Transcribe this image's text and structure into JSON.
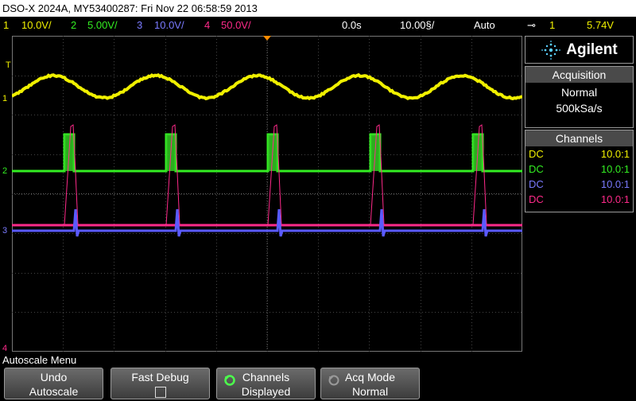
{
  "title": "DSO-X 2024A, MY53400287: Fri Nov 22 06:58:59 2013",
  "status": {
    "ch1_num": "1",
    "ch1_scale": "10.0V/",
    "ch2_num": "2",
    "ch2_scale": "5.00V/",
    "ch3_num": "3",
    "ch3_scale": "10.0V/",
    "ch4_num": "4",
    "ch4_scale": "50.0V/",
    "time_delay": "0.0s",
    "time_scale": "10.00§/",
    "trigger_mode": "Auto",
    "trigger_source": "1",
    "trigger_level": "5.74V"
  },
  "brand": "Agilent",
  "acquisition": {
    "header": "Acquisition",
    "mode": "Normal",
    "rate": "500kSa/s"
  },
  "channels": {
    "header": "Channels",
    "rows": [
      {
        "coupling": "DC",
        "probe": "10.0:1",
        "color": "#f0f000"
      },
      {
        "coupling": "DC",
        "probe": "10.0:1",
        "color": "#33ee22"
      },
      {
        "coupling": "DC",
        "probe": "10.0:1",
        "color": "#7a7aff"
      },
      {
        "coupling": "DC",
        "probe": "10.0:1",
        "color": "#ff2a8a"
      }
    ]
  },
  "markers": {
    "trigger": "T",
    "ch1": "1",
    "ch2": "2",
    "ch3": "3",
    "ch4": "4"
  },
  "menu": {
    "title": "Autoscale Menu",
    "keys": [
      {
        "line1": "Undo",
        "line2": "Autoscale"
      },
      {
        "line1": "Fast Debug",
        "line2": ""
      },
      {
        "line1": "Channels",
        "line2": "Displayed"
      },
      {
        "line1": "Acq Mode",
        "line2": "Normal"
      }
    ]
  },
  "colors": {
    "ch1": "#f0f000",
    "ch2": "#33ee22",
    "ch3": "#5a5aff",
    "ch4": "#ff2a8a",
    "grid": "#555555",
    "trigger_marker": "#ff8c00"
  }
}
